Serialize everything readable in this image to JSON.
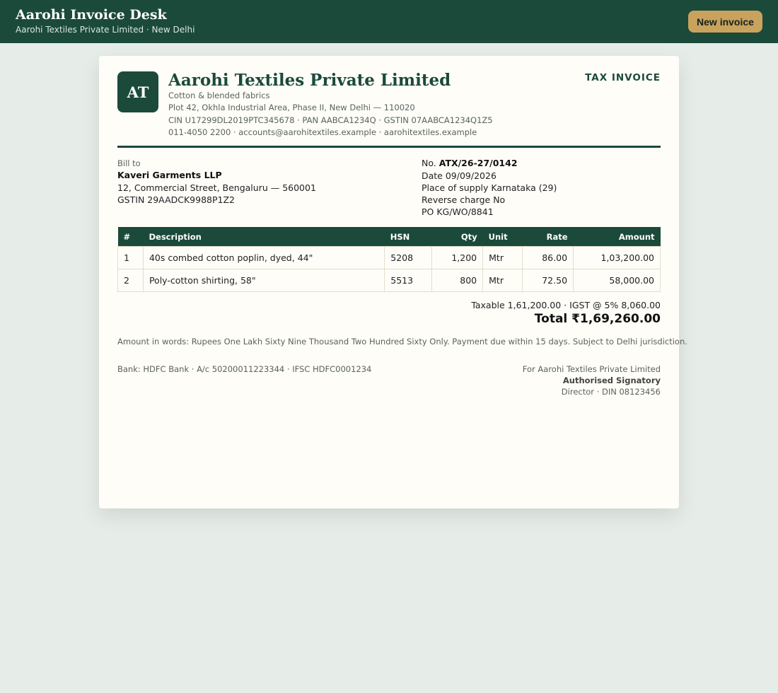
{
  "app": {
    "title": "Aarohi Invoice Desk",
    "subtitle": "Aarohi Textiles Private Limited · New Delhi",
    "new_invoice_label": "New invoice"
  },
  "company": {
    "logo_text": "AT",
    "name": "Aarohi Textiles Private Limited",
    "tagline": "Cotton & blended fabrics",
    "address": "Plot 42, Okhla Industrial Area, Phase II, New Delhi — 110020",
    "registration": "CIN U17299DL2019PTC345678 · PAN AABCA1234Q · GSTIN 07AABCA1234Q1Z5",
    "contact": "011-4050 2200 · accounts@aarohitextiles.example · aarohitextiles.example"
  },
  "document_type": "TAX INVOICE",
  "bill_to": {
    "label": "Bill to",
    "name": "Kaveri Garments LLP",
    "address": "12, Commercial Street, Bengaluru — 560001",
    "gstin": "GSTIN 29AADCK9988P1Z2"
  },
  "invoice_meta": {
    "number_label": "No.",
    "number": "ATX/26-27/0142",
    "date": "Date 09/09/2026",
    "place_of_supply": "Place of supply Karnataka (29)",
    "reverse_charge": "Reverse charge No",
    "po": "PO KG/WO/8841"
  },
  "table": {
    "headers": {
      "num": "#",
      "description": "Description",
      "hsn": "HSN",
      "qty": "Qty",
      "unit": "Unit",
      "rate": "Rate",
      "amount": "Amount"
    },
    "rows": [
      {
        "num": "1",
        "description": "40s combed cotton poplin, dyed, 44\"",
        "hsn": "5208",
        "qty": "1,200",
        "unit": "Mtr",
        "rate": "86.00",
        "amount": "1,03,200.00"
      },
      {
        "num": "2",
        "description": "Poly-cotton shirting, 58\"",
        "hsn": "5513",
        "qty": "800",
        "unit": "Mtr",
        "rate": "72.50",
        "amount": "58,000.00"
      }
    ]
  },
  "totals": {
    "taxable_line": "Taxable 1,61,200.00 · IGST @ 5% 8,060.00",
    "total_line": "Total ₹1,69,260.00"
  },
  "amount_in_words": "Amount in words: Rupees One Lakh Sixty Nine Thousand Two Hundred Sixty Only. Payment due within 15 days. Subject to Delhi jurisdiction.",
  "bank": "Bank: HDFC Bank · A/c 50200011223344 · IFSC HDFC0001234",
  "signatory": {
    "for_line": "For Aarohi Textiles Private Limited",
    "title": "Authorised Signatory",
    "designation": "Director · DIN 08123456"
  },
  "colors": {
    "brand": "#1b4a3a",
    "accent": "#c9a25e",
    "background": "#e6ece8",
    "paper": "#fefdf8"
  }
}
